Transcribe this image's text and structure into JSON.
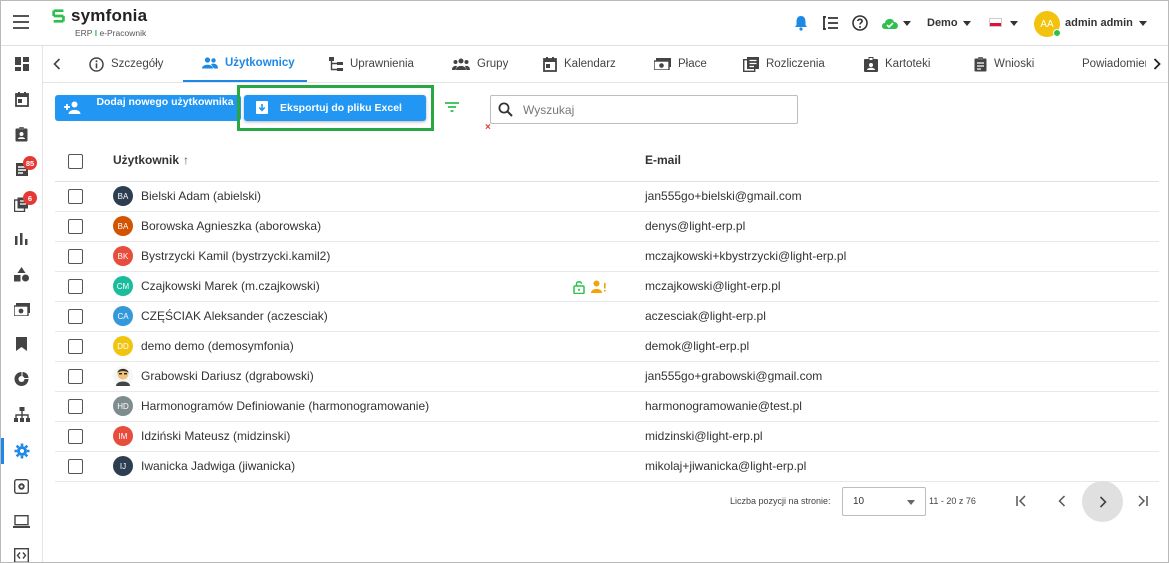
{
  "app": {
    "logo_name": "symfonia",
    "logo_sub_erp": "ERP",
    "logo_sub_sep": "I",
    "logo_sub_product": "e-Pracownik"
  },
  "header": {
    "company": "Demo",
    "avatar_initials": "AA",
    "user_name": "admin admin",
    "status_color": "#2fbf4f",
    "icons": [
      "bell-icon",
      "list-icon",
      "help-icon",
      "cloud-status-icon",
      "flag-pl-icon"
    ]
  },
  "sidebar": {
    "badges": {
      "documents": "85",
      "requests": "6"
    },
    "items": [
      "dashboard-icon",
      "calendar-icon",
      "clipboard-icon",
      "documents-icon",
      "requests-icon",
      "chart-icon",
      "shapes-icon",
      "payroll-icon",
      "bookmark-icon",
      "pie-icon",
      "org-icon",
      "settings-icon",
      "settings-box-icon",
      "laptop-icon",
      "code-icon"
    ]
  },
  "tabs": [
    {
      "label": "Szczegóły",
      "icon": "info-icon"
    },
    {
      "label": "Użytkownicy",
      "icon": "users-icon"
    },
    {
      "label": "Uprawnienia",
      "icon": "tree-icon"
    },
    {
      "label": "Grupy",
      "icon": "groups-icon"
    },
    {
      "label": "Kalendarz",
      "icon": "calendar-icon"
    },
    {
      "label": "Płace",
      "icon": "money-icon"
    },
    {
      "label": "Rozliczenia",
      "icon": "ledger-icon"
    },
    {
      "label": "Kartoteki",
      "icon": "badge-icon"
    },
    {
      "label": "Wnioski",
      "icon": "clipboard-icon"
    },
    {
      "label": "Powiadomienia",
      "icon": "notification-icon"
    }
  ],
  "toolbar": {
    "add_user_label": "Dodaj nowego użytkownika",
    "export_label": "Eksportuj do pliku Excel",
    "search_placeholder": "Wyszukaj",
    "clear_label": "×"
  },
  "table": {
    "col_user": "Użytkownik",
    "col_email": "E-mail",
    "sort_indicator": "↑",
    "rows": [
      {
        "initials": "BA",
        "color": "#2c3e50",
        "name": "Bielski Adam (abielski)",
        "email": "jan555go+bielski@gmail.com"
      },
      {
        "initials": "BA",
        "color": "#d35400",
        "name": "Borowska Agnieszka (aborowska)",
        "email": "denys@light-erp.pl"
      },
      {
        "initials": "BK",
        "color": "#e74c3c",
        "name": "Bystrzycki Kamil (bystrzycki.kamil2)",
        "email": "mczajkowski+kbystrzycki@light-erp.pl"
      },
      {
        "initials": "CM",
        "color": "#1abc9c",
        "name": "Czajkowski Marek (m.czajkowski)",
        "email": "mczajkowski@light-erp.pl",
        "flags": [
          "lock-open-icon",
          "user-warning-icon"
        ]
      },
      {
        "initials": "CA",
        "color": "#3498db",
        "name": "CZĘŚCIAK Aleksander (aczesciak)",
        "email": "aczesciak@light-erp.pl"
      },
      {
        "initials": "DD",
        "color": "#f1c40f",
        "name": "demo demo (demosymfonia)",
        "email": "demok@light-erp.pl"
      },
      {
        "initials": "",
        "color": "#f4d03f",
        "photo": true,
        "name": "Grabowski Dariusz (dgrabowski)",
        "email": "jan555go+grabowski@gmail.com"
      },
      {
        "initials": "HD",
        "color": "#7f8c8d",
        "name": "Harmonogramów Definiowanie (harmonogramowanie)",
        "email": "harmonogramowanie@test.pl"
      },
      {
        "initials": "IM",
        "color": "#e74c3c",
        "name": "Idziński Mateusz (midzinski)",
        "email": "midzinski@light-erp.pl"
      },
      {
        "initials": "IJ",
        "color": "#2c3e50",
        "name": "Iwanicka Jadwiga (jiwanicka)",
        "email": "mikolaj+jiwanicka@light-erp.pl"
      }
    ]
  },
  "pagination": {
    "per_page_label": "Liczba pozycji na stronie:",
    "per_page_value": "10",
    "range": "11 - 20 z 76"
  }
}
